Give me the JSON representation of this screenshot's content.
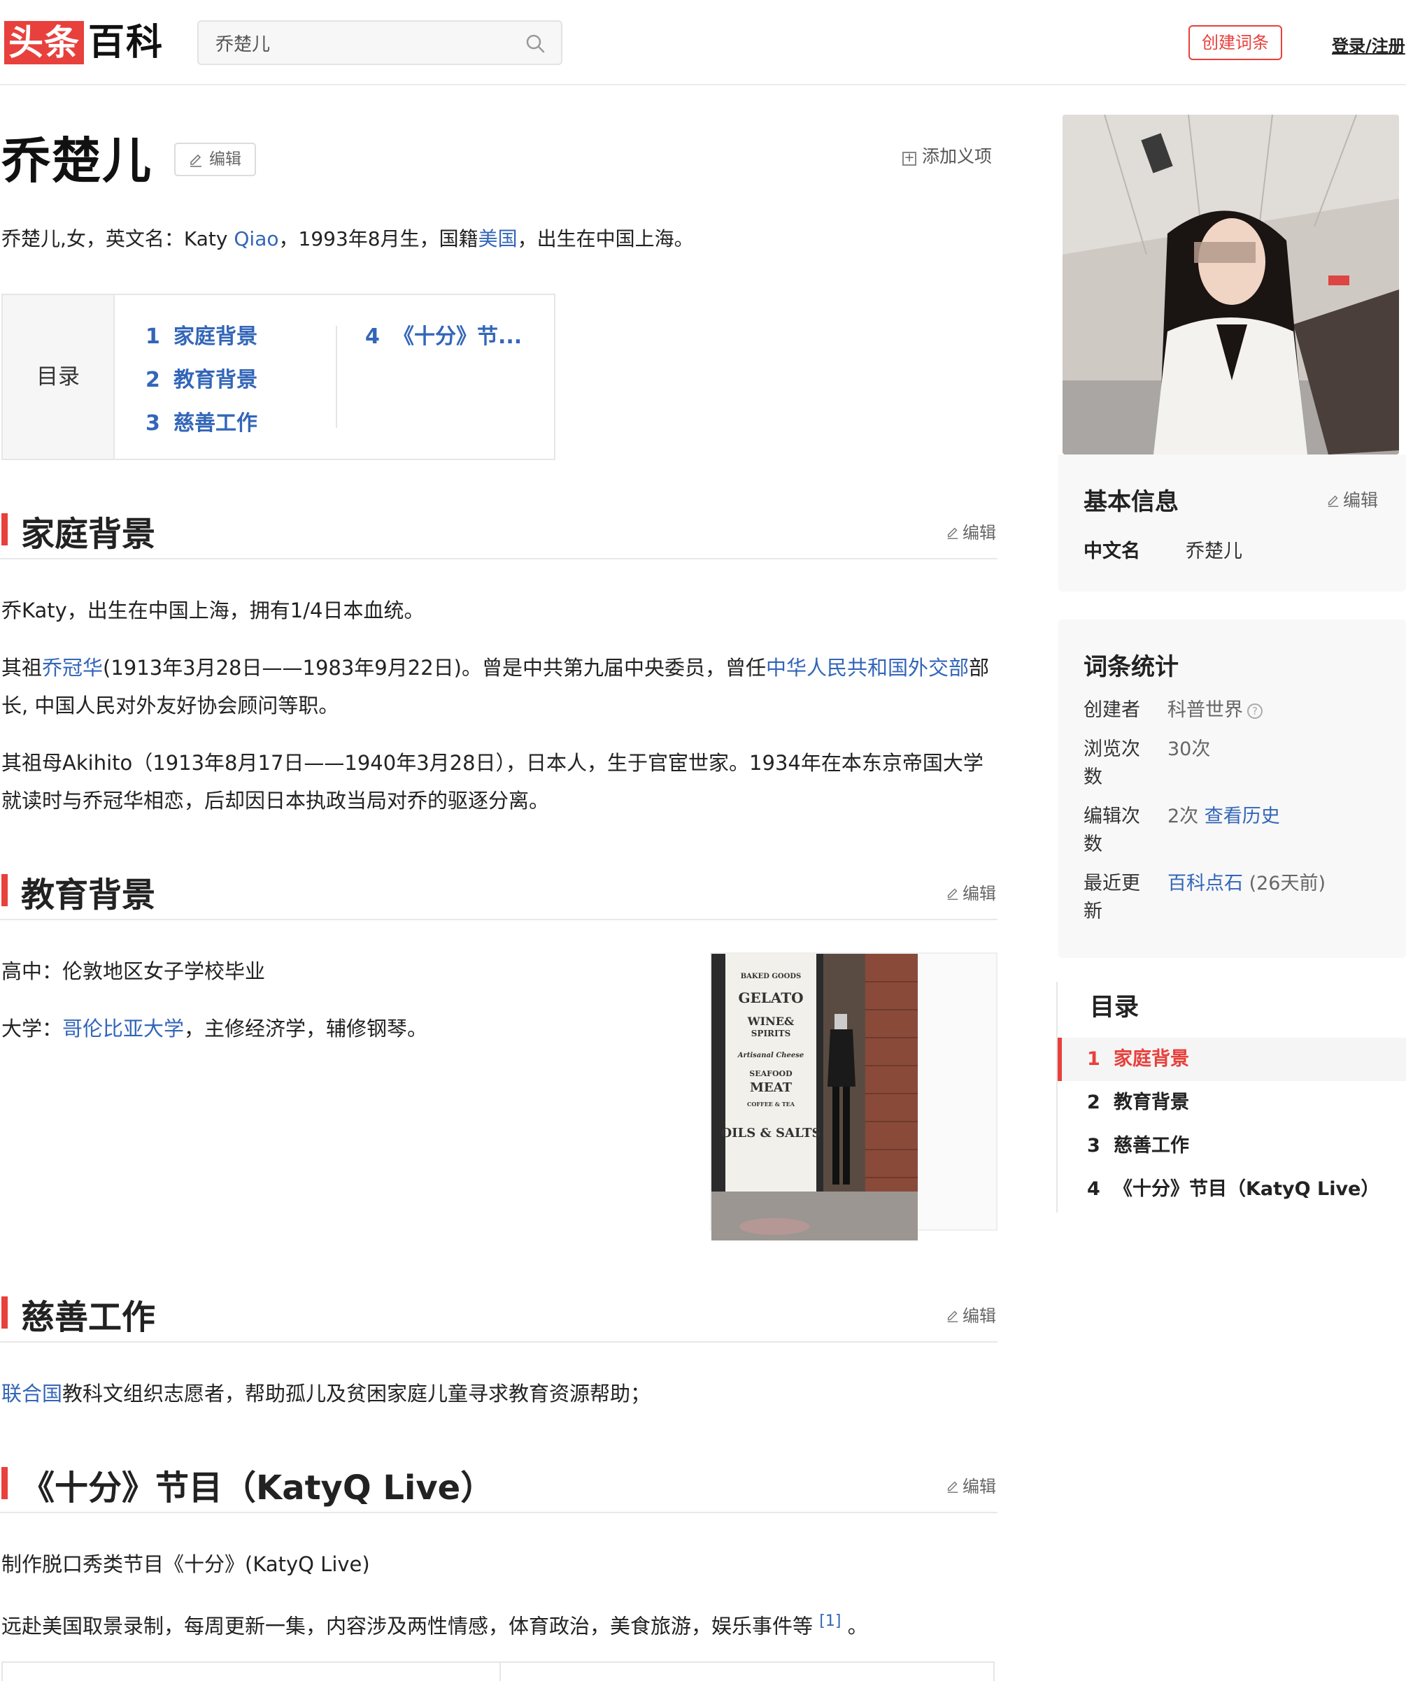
{
  "header": {
    "logo_part1": "头条",
    "logo_part2": "百科",
    "search_value": "乔楚儿",
    "create_button": "创建词条",
    "login_link": "登录/注册"
  },
  "article": {
    "title": "乔楚儿",
    "edit_label": "编辑",
    "add_meaning": "添加义项",
    "summary": {
      "pre": "乔楚儿,女，英文名：Katy ",
      "link1": "Qiao",
      "mid": "，1993年8月生，国籍",
      "link2": "美国",
      "post": "，出生在中国上海。"
    },
    "toc": {
      "label": "目录",
      "items": [
        {
          "num": "1",
          "text": "家庭背景"
        },
        {
          "num": "2",
          "text": "教育背景"
        },
        {
          "num": "3",
          "text": "慈善工作"
        },
        {
          "num": "4",
          "text": "《十分》节..."
        }
      ]
    },
    "sections": [
      {
        "title": "家庭背景",
        "edit": "编辑",
        "p1": "乔Katy，出生在中国上海，拥有1/4日本血统。",
        "p2_pre": "其祖",
        "p2_link1": "乔冠华",
        "p2_mid": "(1913年3月28日——1983年9月22日)。曾是中共第九届中央委员，曾任",
        "p2_link2": "中华人民共和国外交部",
        "p2_post": "部长, 中国人民对外友好协会顾问等职。",
        "p3": "其祖母Akihito（1913年8月17日——1940年3月28日），日本人，生于官宦世家。1934年在本东京帝国大学就读时与乔冠华相恋，后却因日本执政当局对乔的驱逐分离。"
      },
      {
        "title": "教育背景",
        "edit": "编辑",
        "p1": "高中：伦敦地区女子学校毕业",
        "p2_pre": "大学：",
        "p2_link": "哥伦比亚大学",
        "p2_post": "，主修经济学，辅修钢琴。",
        "caption": "."
      },
      {
        "title": "慈善工作",
        "edit": "编辑",
        "p1_link": "联合国",
        "p1_post": "教科文组织志愿者，帮助孤儿及贫困家庭儿童寻求教育资源帮助；"
      },
      {
        "title": "《十分》节目（KatyQ Live）",
        "edit": "编辑",
        "p1": "制作脱口秀类节目《十分》(KatyQ Live)",
        "p2": "远赴美国取景录制，每周更新一集，内容涉及两性情感，体育政治，美食旅游，娱乐事件等",
        "p2_ref": "[1]",
        "p2_end": "。"
      }
    ]
  },
  "sidebar": {
    "basic_info": {
      "title": "基本信息",
      "edit": "编辑",
      "key": "中文名",
      "value": "乔楚儿"
    },
    "stats": {
      "title": "词条统计",
      "creator_label": "创建者",
      "creator_value": "科普世界",
      "views_label": "浏览次数",
      "views_value": "30次",
      "edits_label": "编辑次数",
      "edits_value": "2次",
      "history_link": "查看历史",
      "updated_label": "最近更新",
      "updated_user": "百科点石",
      "updated_time": "(26天前)"
    },
    "toc": {
      "title": "目录",
      "items": [
        {
          "num": "1",
          "text": "家庭背景"
        },
        {
          "num": "2",
          "text": "教育背景"
        },
        {
          "num": "3",
          "text": "慈善工作"
        },
        {
          "num": "4",
          "text": "《十分》节目（KatyQ Live）"
        }
      ]
    }
  },
  "colors": {
    "accent": "#e8403c",
    "link": "#3366b8"
  }
}
